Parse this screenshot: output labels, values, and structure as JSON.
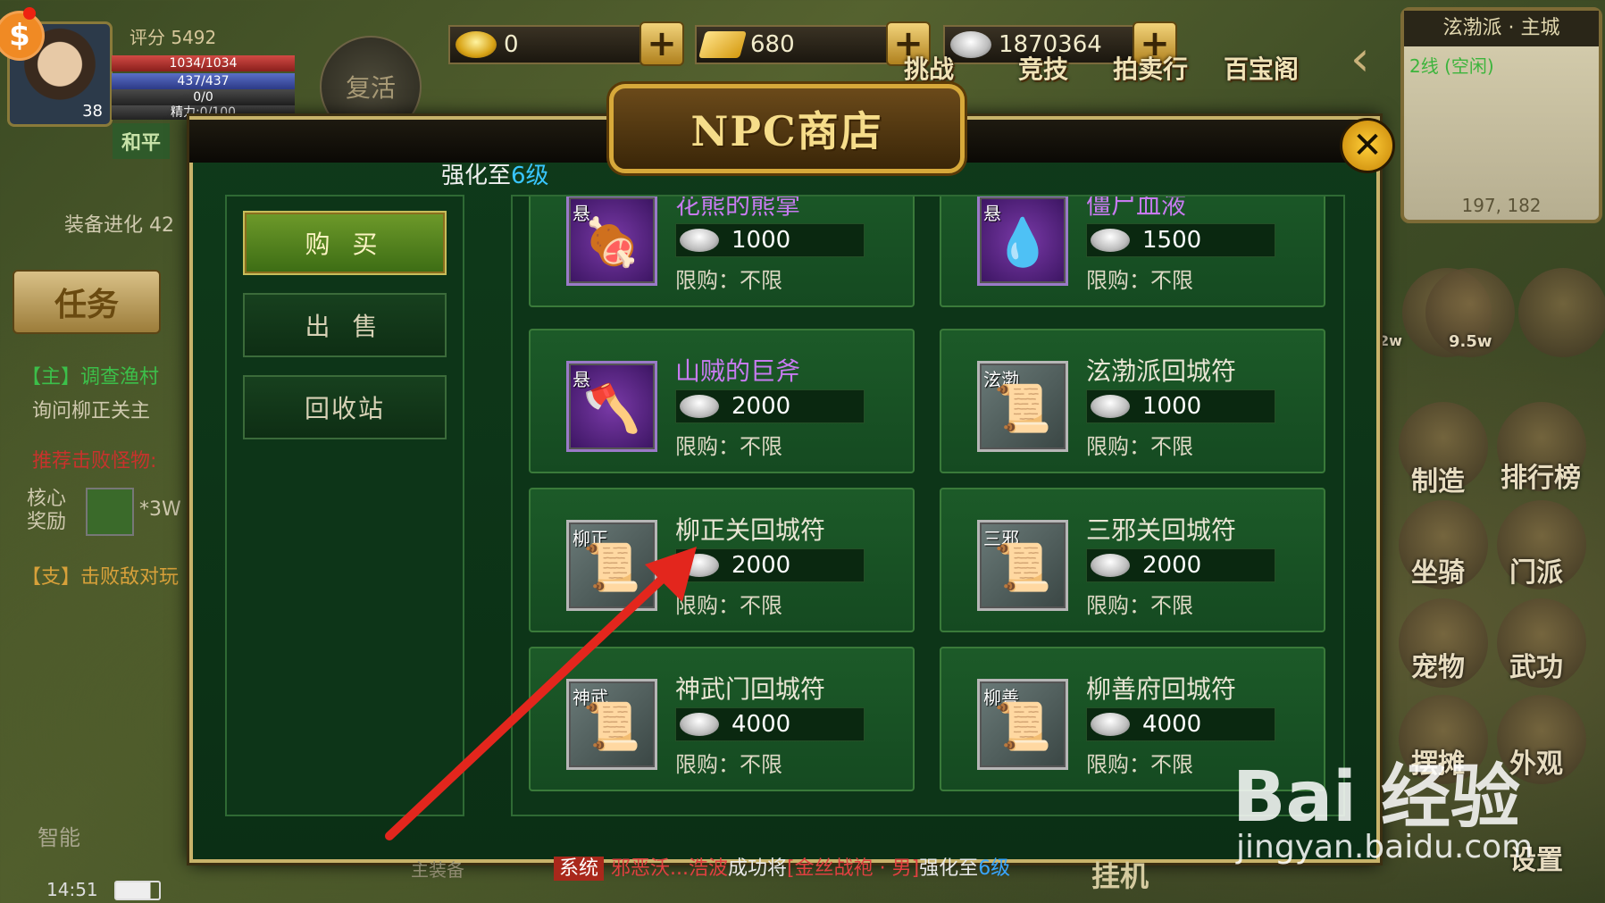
{
  "hud": {
    "score": "评分 5492",
    "level": "38",
    "hp": "1034/1034",
    "mp": "437/437",
    "xp": "0/0",
    "energy": "精力:0/100",
    "revive": "复活",
    "peace_mode": "和平",
    "coin_badge": "$",
    "currencies": [
      {
        "icon": "gold-ingot-icon",
        "value": "0"
      },
      {
        "icon": "gold-bar-icon",
        "value": "680"
      },
      {
        "icon": "silver-ingot-icon",
        "value": "1870364"
      }
    ],
    "plus_label": "+",
    "top_buttons": [
      "挑战",
      "竞技",
      "拍卖行",
      "百宝阁"
    ],
    "minimap": {
      "title": "泫渤派 · 主城",
      "line": "2线 (空闲)",
      "coords": "197, 182"
    }
  },
  "left_panel": {
    "equip_evolve": "装备进化 42",
    "task_button": "任务",
    "main_quest": "【主】调查渔村",
    "main_quest_desc": "询问柳正关主",
    "recommend": "推荐击败怪物:",
    "core_reward_label": "核心\n奖励",
    "core_reward_value": "*3W",
    "side_quest": "【支】击败敌对玩",
    "smart": "智能"
  },
  "right_panel": {
    "buttons": [
      "制造",
      "排行榜",
      "坐骑",
      "门派",
      "宠物",
      "武功",
      "摆摊",
      "外观",
      "设置"
    ],
    "values": [
      "2w",
      "9.5w"
    ]
  },
  "shop": {
    "title": "NPC商店",
    "close": "✕",
    "scroll_caption_prefix": "强化至",
    "scroll_caption_hl": "6级",
    "tabs": [
      {
        "label": "购 买",
        "active": true
      },
      {
        "label": "出 售",
        "active": false
      },
      {
        "label": "回收站",
        "active": false
      }
    ],
    "items": [
      {
        "name": "花熊的熊掌",
        "tag": "悬",
        "price": "1000",
        "limit": "限购：不限",
        "rarity": "purple",
        "icon": "meat-icon"
      },
      {
        "name": "僵尸血液",
        "tag": "悬",
        "price": "1500",
        "limit": "限购：不限",
        "rarity": "purple",
        "icon": "green-drop-icon"
      },
      {
        "name": "山贼的巨斧",
        "tag": "悬",
        "price": "2000",
        "limit": "限购：不限",
        "rarity": "purple",
        "icon": "axe-icon"
      },
      {
        "name": "泫渤派回城符",
        "tag": "泫渤",
        "price": "1000",
        "limit": "限购：不限",
        "rarity": "normal",
        "icon": "scroll-icon"
      },
      {
        "name": "柳正关回城符",
        "tag": "柳正",
        "price": "2000",
        "limit": "限购：不限",
        "rarity": "normal",
        "icon": "scroll-icon"
      },
      {
        "name": "三邪关回城符",
        "tag": "三邪",
        "price": "2000",
        "limit": "限购：不限",
        "rarity": "normal",
        "icon": "scroll-icon"
      },
      {
        "name": "神武门回城符",
        "tag": "神武",
        "price": "4000",
        "limit": "限购：不限",
        "rarity": "normal",
        "icon": "scroll-icon"
      },
      {
        "name": "柳善府回城符",
        "tag": "柳善",
        "price": "4000",
        "limit": "限购：不限",
        "rarity": "normal",
        "icon": "scroll-icon"
      }
    ]
  },
  "bottom": {
    "main_equip": "主装备",
    "chat_sys": "系统",
    "chat_player": "邪恶沃...浩波",
    "chat_mid": "成功将",
    "chat_item": "[金丝战袍 · 男]",
    "chat_mid2": "强化至",
    "chat_level": "6级",
    "hang": "挂机",
    "time": "14:51"
  },
  "watermark": {
    "main": "Bai 经验",
    "url": "jingyan.baidu.com"
  }
}
